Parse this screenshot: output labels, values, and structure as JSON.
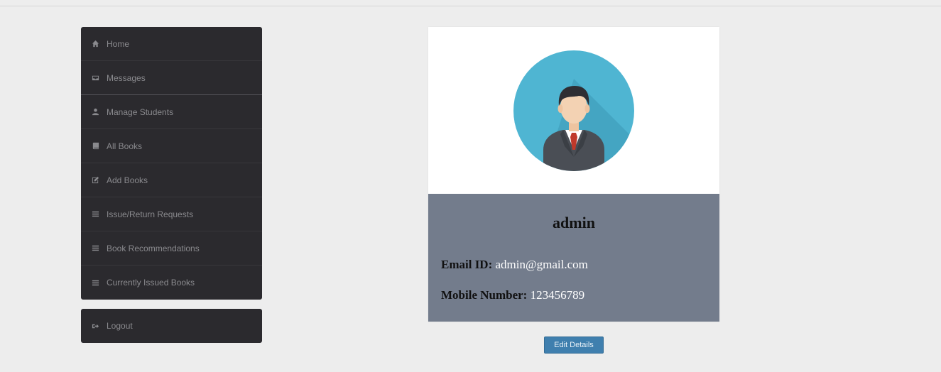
{
  "sidebar": {
    "items": [
      {
        "label": "Home",
        "icon": "home-icon"
      },
      {
        "label": "Messages",
        "icon": "inbox-icon"
      },
      {
        "label": "Manage Students",
        "icon": "user-icon"
      },
      {
        "label": "All Books",
        "icon": "book-icon"
      },
      {
        "label": "Add Books",
        "icon": "edit-icon"
      },
      {
        "label": "Issue/Return Requests",
        "icon": "list-icon"
      },
      {
        "label": "Book Recommendations",
        "icon": "list-icon"
      },
      {
        "label": "Currently Issued Books",
        "icon": "list-icon"
      }
    ],
    "logout": {
      "label": "Logout",
      "icon": "sign-out-icon"
    }
  },
  "profile": {
    "username": "admin",
    "email_label": "Email ID:",
    "email": "admin@gmail.com",
    "mobile_label": "Mobile Number:",
    "mobile": "123456789",
    "avatar": "admin-avatar"
  },
  "actions": {
    "edit_label": "Edit Details"
  },
  "colors": {
    "sidebar_bg": "#2b2a2e",
    "info_bg": "#737c8c",
    "button_bg": "#3f7fae",
    "avatar_bg": "#4fb5d2"
  }
}
